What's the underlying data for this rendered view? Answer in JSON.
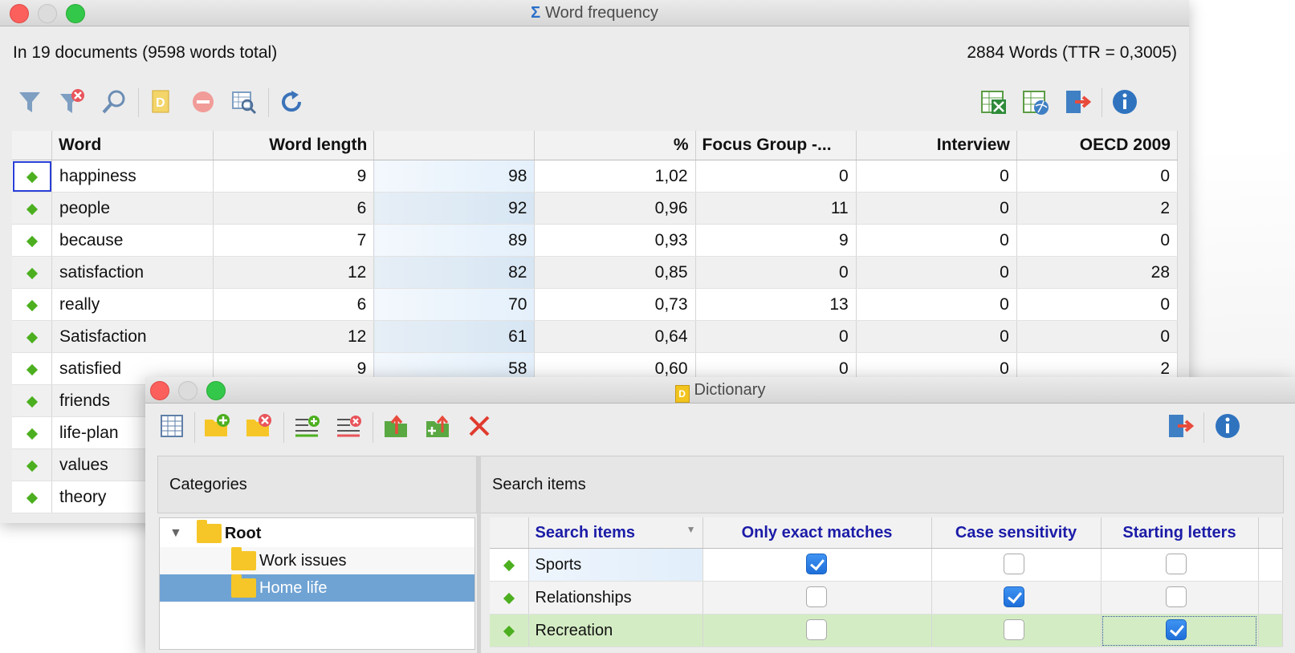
{
  "word_frequency": {
    "title": "Word frequency",
    "summary_left": "In 19 documents  (9598 words total)",
    "summary_right": "2884 Words (TTR = 0,3005)",
    "toolbar_left": [
      "filter-icon",
      "clear-filter-icon",
      "search-icon",
      "dictionary-icon",
      "stop-icon",
      "find-in-table-icon",
      "refresh-icon"
    ],
    "toolbar_right": [
      "export-excel-icon",
      "export-html-icon",
      "export-exit-icon",
      "info-icon"
    ],
    "columns": [
      "Word",
      "Word length",
      "",
      "%",
      "Focus Group -...",
      "Interview",
      "OECD 2009"
    ],
    "rows": [
      {
        "word": "happiness",
        "length": "9",
        "freq": "98",
        "pct": "1,02",
        "focus": "0",
        "interview": "0",
        "oecd": "0"
      },
      {
        "word": "people",
        "length": "6",
        "freq": "92",
        "pct": "0,96",
        "focus": "11",
        "interview": "0",
        "oecd": "2"
      },
      {
        "word": "because",
        "length": "7",
        "freq": "89",
        "pct": "0,93",
        "focus": "9",
        "interview": "0",
        "oecd": "0"
      },
      {
        "word": "satisfaction",
        "length": "12",
        "freq": "82",
        "pct": "0,85",
        "focus": "0",
        "interview": "0",
        "oecd": "28"
      },
      {
        "word": "really",
        "length": "6",
        "freq": "70",
        "pct": "0,73",
        "focus": "13",
        "interview": "0",
        "oecd": "0"
      },
      {
        "word": "Satisfaction",
        "length": "12",
        "freq": "61",
        "pct": "0,64",
        "focus": "0",
        "interview": "0",
        "oecd": "0"
      },
      {
        "word": "satisfied",
        "length": "9",
        "freq": "58",
        "pct": "0,60",
        "focus": "0",
        "interview": "0",
        "oecd": "2"
      },
      {
        "word": "friends",
        "length": "",
        "freq": "",
        "pct": "",
        "focus": "",
        "interview": "",
        "oecd": ""
      },
      {
        "word": "life-plan",
        "length": "",
        "freq": "",
        "pct": "",
        "focus": "",
        "interview": "",
        "oecd": ""
      },
      {
        "word": "values",
        "length": "",
        "freq": "",
        "pct": "",
        "focus": "",
        "interview": "",
        "oecd": ""
      },
      {
        "word": "theory",
        "length": "",
        "freq": "",
        "pct": "",
        "focus": "",
        "interview": "",
        "oecd": ""
      }
    ]
  },
  "dictionary": {
    "title": "Dictionary",
    "categories_label": "Categories",
    "search_items_label": "Search items",
    "tree": [
      {
        "label": "Root",
        "level": 0,
        "expanded": true
      },
      {
        "label": "Work issues",
        "level": 1
      },
      {
        "label": "Home life",
        "level": 1,
        "selected": true
      }
    ],
    "columns": [
      "Search items",
      "Only exact matches",
      "Case sensitivity",
      "Starting letters"
    ],
    "items": [
      {
        "label": "Sports",
        "exact": true,
        "case": false,
        "starting": false
      },
      {
        "label": "Relationships",
        "exact": false,
        "case": true,
        "starting": false
      },
      {
        "label": "Recreation",
        "exact": false,
        "case": false,
        "starting": true
      }
    ]
  },
  "colors": {
    "accent": "#1e6fd9",
    "selection": "#6fa3d4",
    "highlight_row": "#d4ecc4",
    "diamond": "#4caf1f"
  }
}
